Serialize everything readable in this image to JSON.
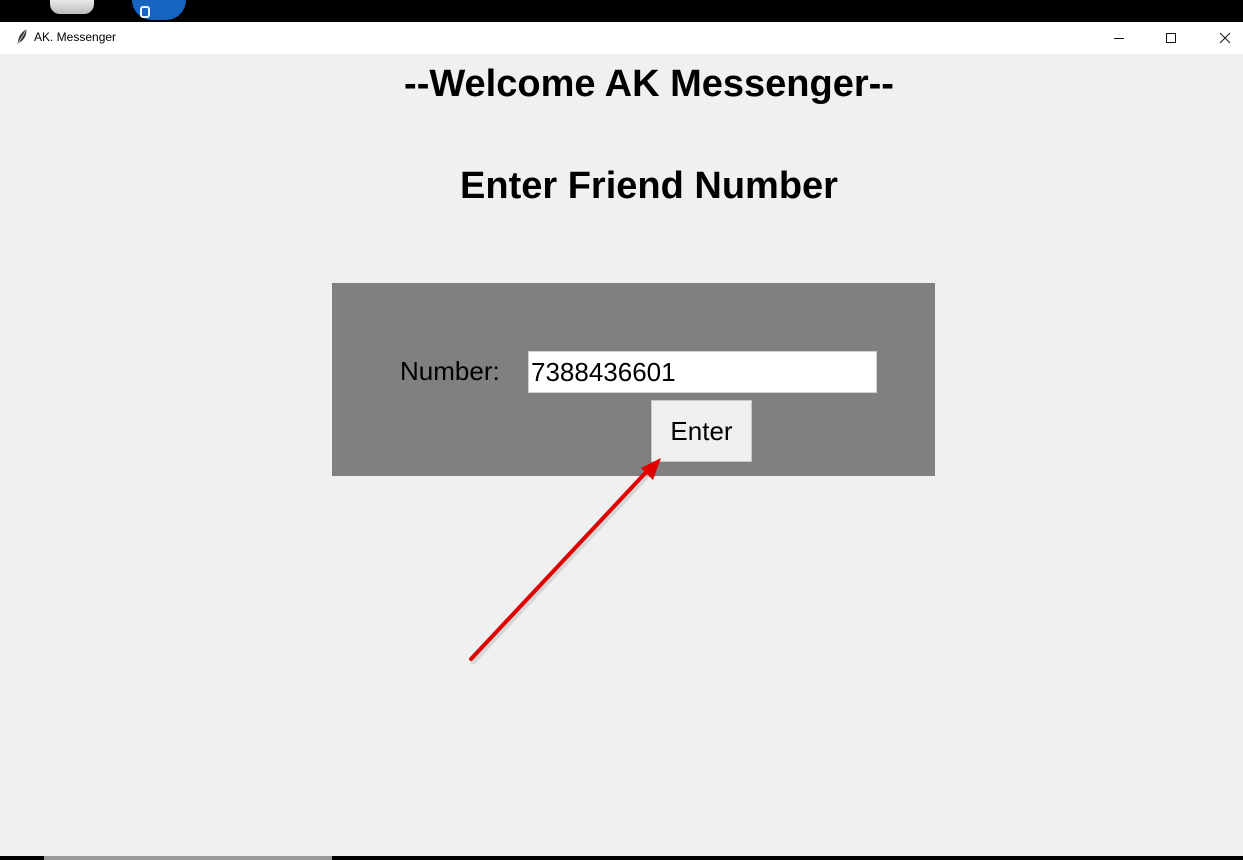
{
  "window": {
    "title": "AK. Messenger"
  },
  "main": {
    "welcome_title": "--Welcome AK Messenger--",
    "heading": "Enter Friend Number",
    "form": {
      "number_label": "Number:",
      "number_value": "7388436601",
      "enter_label": "Enter"
    }
  },
  "colors": {
    "window_background": "#f0f0f0",
    "form_panel": "#808080",
    "annotation_arrow": "#e00000"
  },
  "icons": {
    "app": "feather-icon",
    "minimize": "minimize-icon",
    "maximize": "maximize-icon",
    "close": "close-icon"
  }
}
